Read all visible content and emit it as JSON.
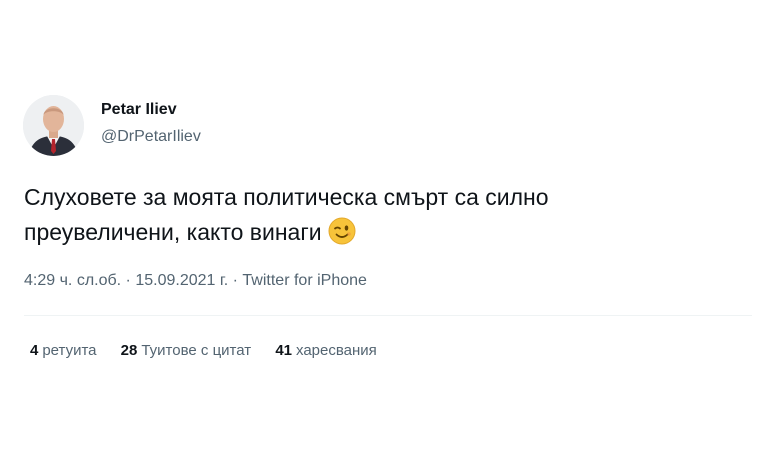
{
  "author": {
    "name": "Petar Iliev",
    "handle": "@DrPetarIliev"
  },
  "tweet": {
    "text_line1": "Слуховете за моята политическа смърт са силно",
    "text_line2": "преувеличени, както винаги",
    "emoji": "winking-face"
  },
  "meta": {
    "time": "4:29 ч. сл.об.",
    "separator1": " · ",
    "date": "15.09.2021 г.",
    "separator2": " · ",
    "source": "Twitter for iPhone"
  },
  "stats": {
    "retweets_count": "4",
    "retweets_label": "ретуита",
    "quotes_count": "28",
    "quotes_label": "Туитове с цитат",
    "likes_count": "41",
    "likes_label": "харесвания"
  },
  "colors": {
    "text": "#0f1419",
    "secondary": "#536471",
    "divider": "#eff3f4",
    "emoji": "#f7c33a"
  }
}
